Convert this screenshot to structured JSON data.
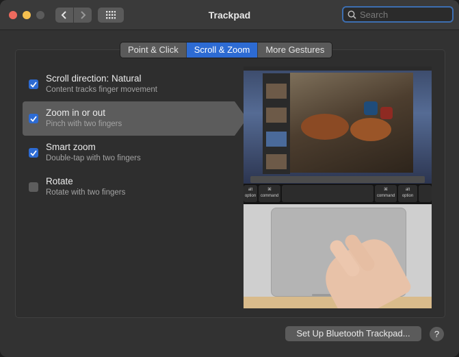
{
  "window": {
    "title": "Trackpad"
  },
  "toolbar": {
    "back_icon": "chevron-left-icon",
    "forward_icon": "chevron-right-icon",
    "grid_icon": "grid-icon"
  },
  "search": {
    "placeholder": "Search",
    "value": ""
  },
  "tabs": [
    {
      "label": "Point & Click",
      "active": false
    },
    {
      "label": "Scroll & Zoom",
      "active": true
    },
    {
      "label": "More Gestures",
      "active": false
    }
  ],
  "options": [
    {
      "title": "Scroll direction: Natural",
      "subtitle": "Content tracks finger movement",
      "checked": true,
      "selected": false
    },
    {
      "title": "Zoom in or out",
      "subtitle": "Pinch with two fingers",
      "checked": true,
      "selected": true
    },
    {
      "title": "Smart zoom",
      "subtitle": "Double-tap with two fingers",
      "checked": true,
      "selected": false
    },
    {
      "title": "Rotate",
      "subtitle": "Rotate with two fingers",
      "checked": false,
      "selected": false
    }
  ],
  "preview": {
    "keys": [
      {
        "top": "alt",
        "bottom": "option"
      },
      {
        "top": "⌘",
        "bottom": "command"
      },
      {
        "top": "⌘",
        "bottom": "command"
      },
      {
        "top": "alt",
        "bottom": "option"
      }
    ]
  },
  "footer": {
    "setup_label": "Set Up Bluetooth Trackpad...",
    "help_label": "?"
  },
  "colors": {
    "accent": "#2d6bd3",
    "close": "#ed6a5e",
    "minimize": "#f5bf4f"
  }
}
